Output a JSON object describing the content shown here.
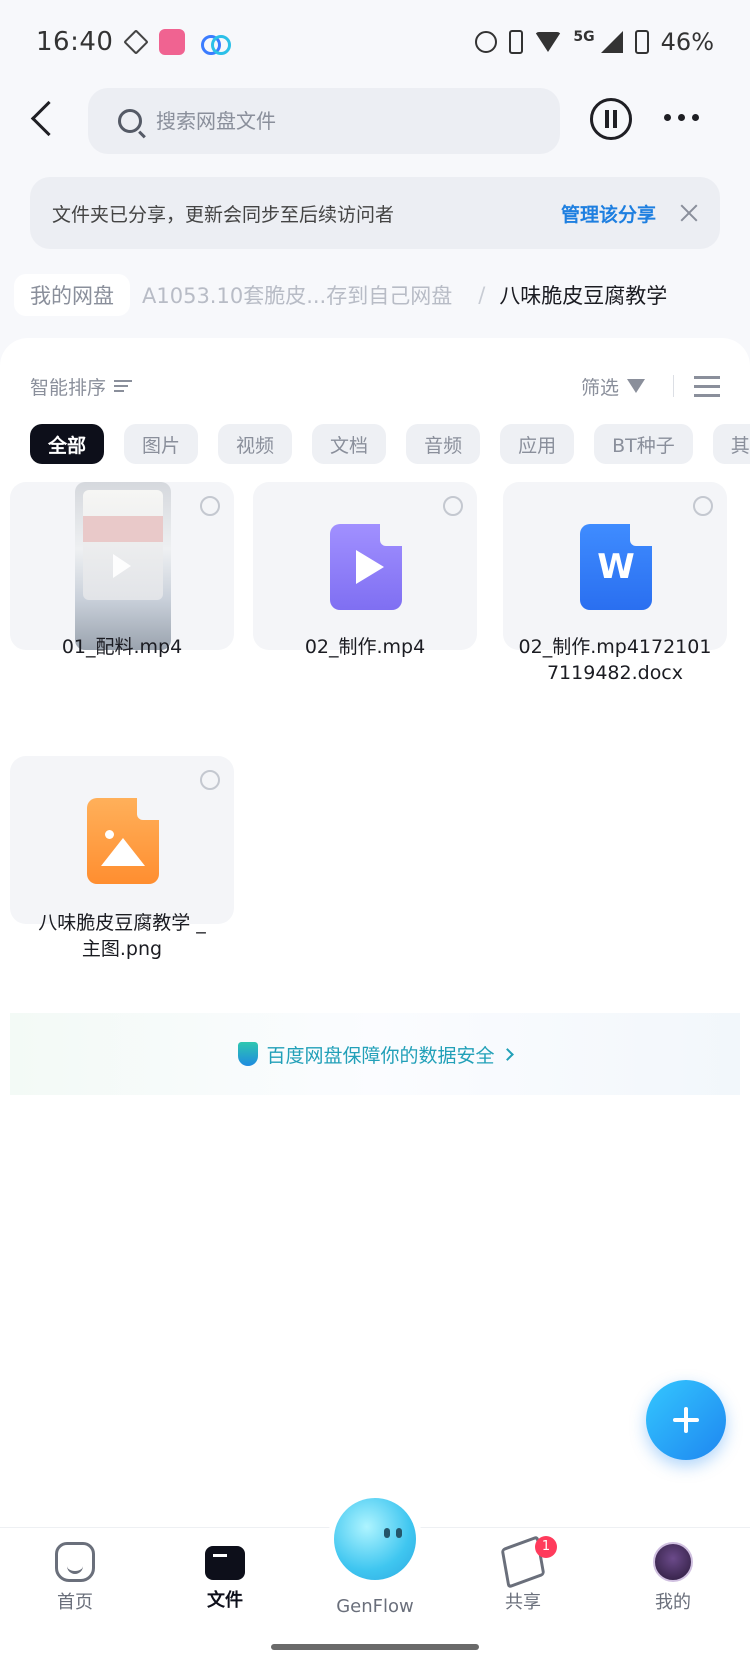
{
  "status_bar": {
    "time": "16:40",
    "network": "5G",
    "battery": "46%"
  },
  "search": {
    "placeholder": "搜索网盘文件"
  },
  "notice": {
    "message": "文件夹已分享，更新会同步至后续访问者",
    "action": "管理该分享"
  },
  "breadcrumb": {
    "root": "我的网盘",
    "middle": "A1053.10套脆皮...存到自己网盘",
    "separator": "/",
    "current": "八味脆皮豆腐教学"
  },
  "toolbar": {
    "sort_label": "智能排序",
    "filter_label": "筛选"
  },
  "categories": [
    "全部",
    "图片",
    "视频",
    "文档",
    "音频",
    "应用",
    "BT种子",
    "其"
  ],
  "files": [
    {
      "name": "01_配料.mp4",
      "type": "video-photo"
    },
    {
      "name": "02_制作.mp4",
      "type": "video"
    },
    {
      "name_line1": "02_制作.mp4172101",
      "name_line2": "7119482.docx",
      "type": "word"
    },
    {
      "name_line1": "八味脆皮豆腐教学 _",
      "name_line2": "主图.png",
      "type": "image"
    }
  ],
  "security_banner": "百度网盘保障你的数据安全",
  "bottom_nav": {
    "home": "首页",
    "files": "文件",
    "genflow": "GenFlow",
    "share": "共享",
    "share_badge": "1",
    "me": "我的"
  },
  "colors": {
    "accent": "#1e7fe0",
    "active_chip": "#0d0f1a",
    "badge": "#ff3b5c"
  }
}
